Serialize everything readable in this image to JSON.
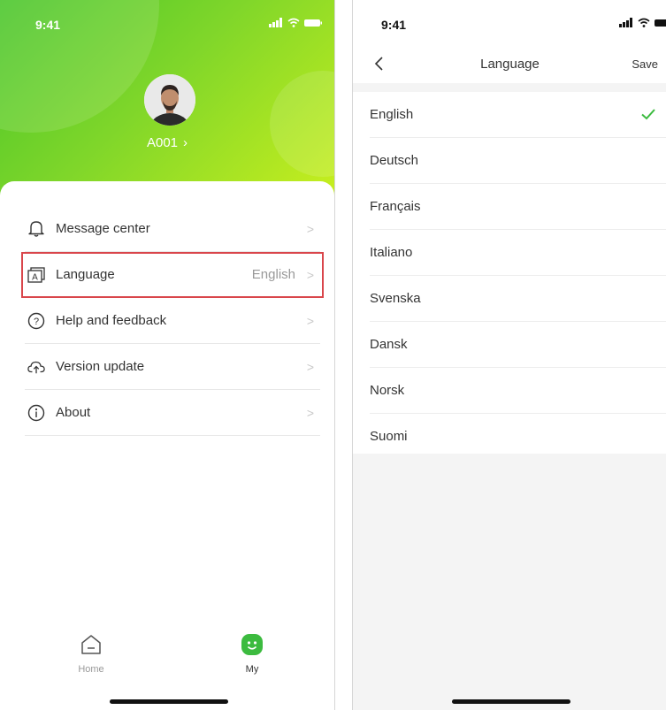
{
  "status_bar": {
    "time": "9:41"
  },
  "profile": {
    "username": "A001",
    "chevron": "›"
  },
  "menu": {
    "items": [
      {
        "label": "Message center",
        "value": "",
        "icon": "bell-icon"
      },
      {
        "label": "Language",
        "value": "English",
        "icon": "language-icon"
      },
      {
        "label": "Help and feedback",
        "value": "",
        "icon": "help-icon"
      },
      {
        "label": "Version update",
        "value": "",
        "icon": "cloud-upload-icon"
      },
      {
        "label": "About",
        "value": "",
        "icon": "info-icon"
      }
    ]
  },
  "tabbar": {
    "home_label": "Home",
    "my_label": "My"
  },
  "language_page": {
    "title": "Language",
    "save_label": "Save",
    "languages": [
      "English",
      "Deutsch",
      "Français",
      "Italiano",
      "Svenska",
      "Dansk",
      "Norsk",
      "Suomi"
    ],
    "selected": "English"
  },
  "colors": {
    "accent": "#3cbb3f",
    "highlight": "#d9464b",
    "gradient_start": "#48c52a",
    "gradient_end": "#c9ef1e"
  }
}
